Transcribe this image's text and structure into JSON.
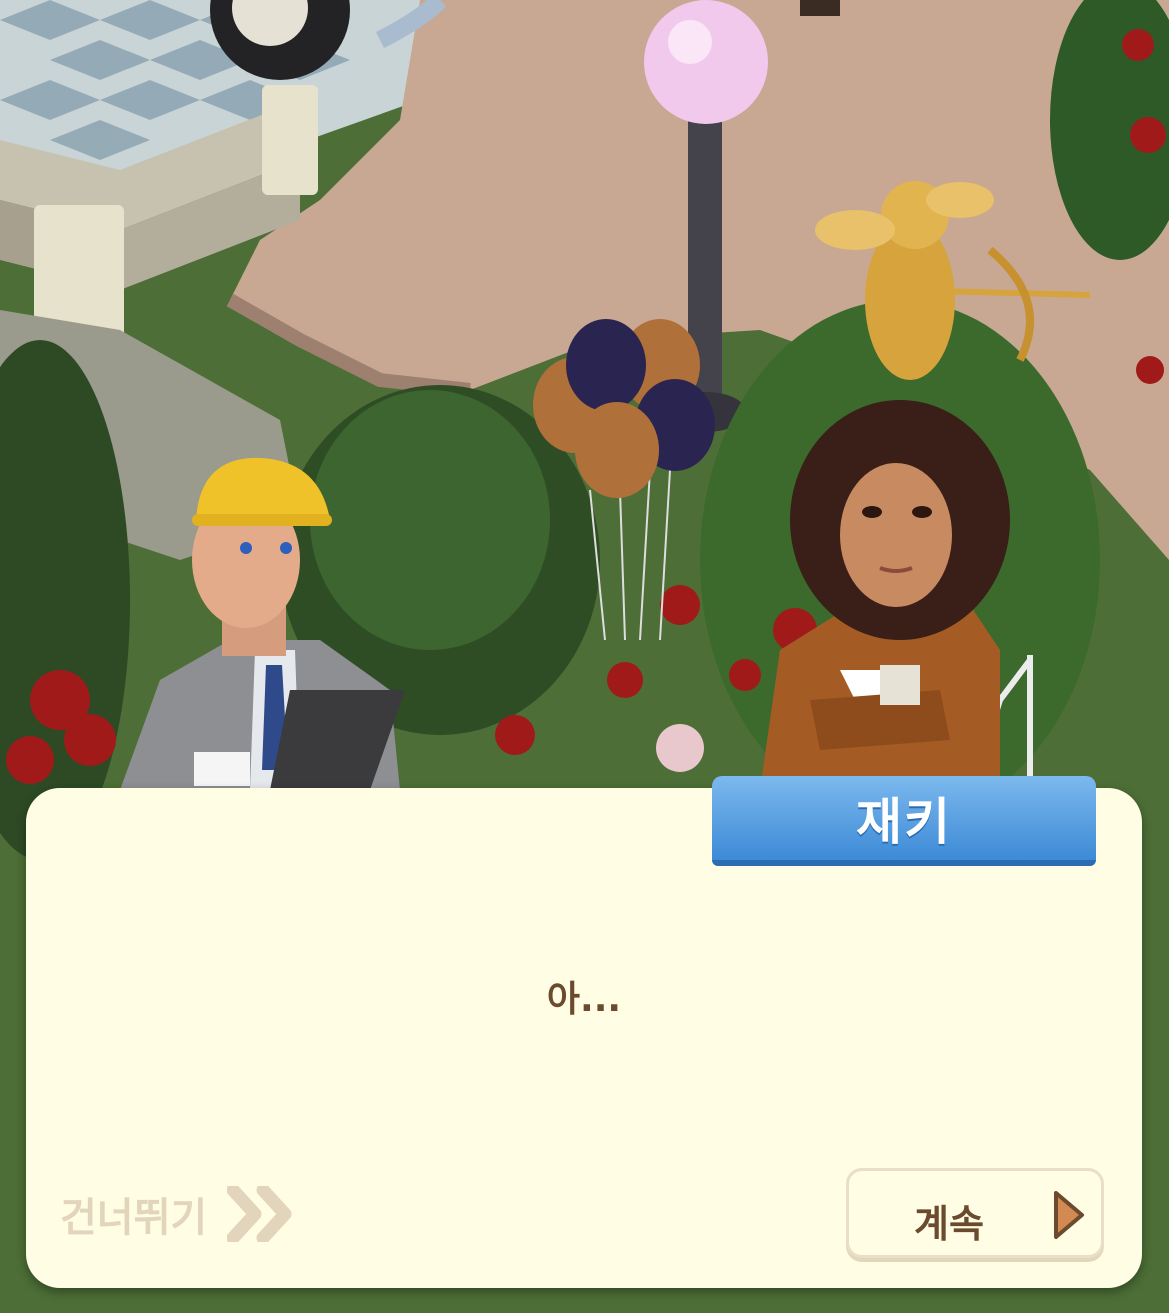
{
  "scene": {
    "characters": [
      {
        "id": "engineer",
        "description": "man-in-hard-hat-with-clipboard"
      },
      {
        "id": "jackie",
        "description": "curly-haired-woman-arms-crossed"
      }
    ]
  },
  "dialog": {
    "speaker": "재키",
    "text": "아...",
    "skip_label": "건너뛰기",
    "continue_label": "계속"
  },
  "icons": {
    "skip": "double-chevron-right-icon",
    "continue": "play-arrow-icon"
  },
  "colors": {
    "dialog_bg": "#fffde4",
    "name_tab": "#4a93dc",
    "text": "#6b4a2e",
    "skip_text": "#e2d5bc",
    "continue_arrow": "#d38a52"
  }
}
